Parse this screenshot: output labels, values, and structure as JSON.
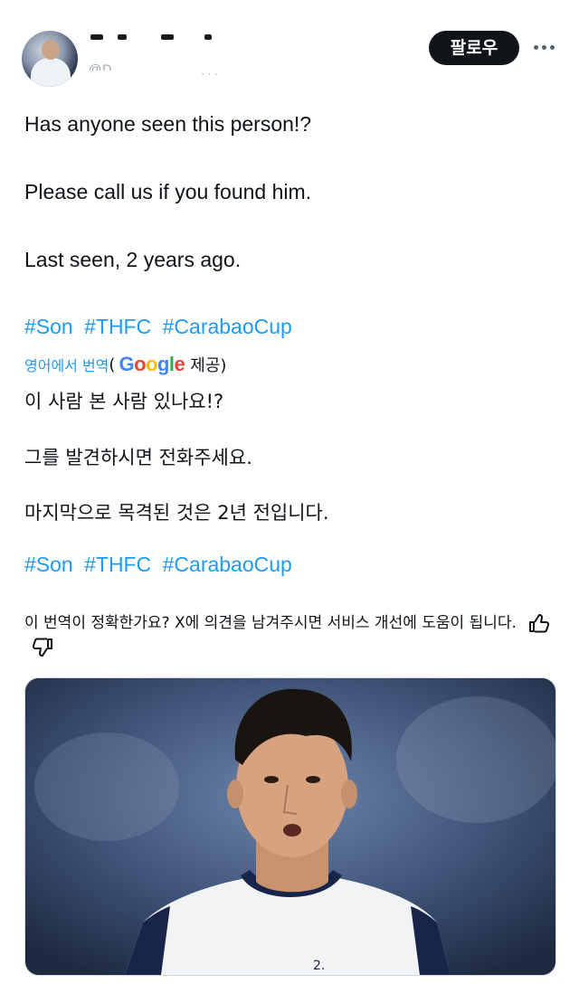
{
  "header": {
    "display_name": "",
    "handle": "@D",
    "follow_label": "팔로우",
    "more_icon": "more-horizontal-icon",
    "avatar_icon": "profile-avatar"
  },
  "tweet": {
    "line1": "Has anyone seen this person!?",
    "line2": "Please call us if you found him.",
    "line3": "Last seen, 2 years ago.",
    "hashtags": [
      "#Son",
      "#THFC",
      "#CarabaoCup"
    ]
  },
  "translation": {
    "link": "영어에서 번역",
    "open_paren": "(",
    "provider": "Google",
    "provider_suffix": "제공)",
    "line1": "이 사람 본 사람 있나요!?",
    "line2": "그를 발견하시면 전화주세요.",
    "line3": "마지막으로 목격된 것은 2년 전입니다.",
    "hashtags": [
      "#Son",
      "#THFC",
      "#CarabaoCup"
    ],
    "feedback_text": "이 번역이 정확한가요? X에 의견을 남겨주시면 서비스 개선에 도움이 됩니다.",
    "thumbs_up_icon": "thumbs-up-icon",
    "thumbs_down_icon": "thumbs-down-icon"
  },
  "media": {
    "image_icon": "tweet-photo"
  },
  "colors": {
    "link": "#1d9bf0",
    "text": "#0f1419",
    "button_bg": "#0f1419",
    "google_blue": "#4285f4",
    "google_red": "#ea4335",
    "google_yellow": "#fbbc05",
    "google_green": "#34a853"
  }
}
